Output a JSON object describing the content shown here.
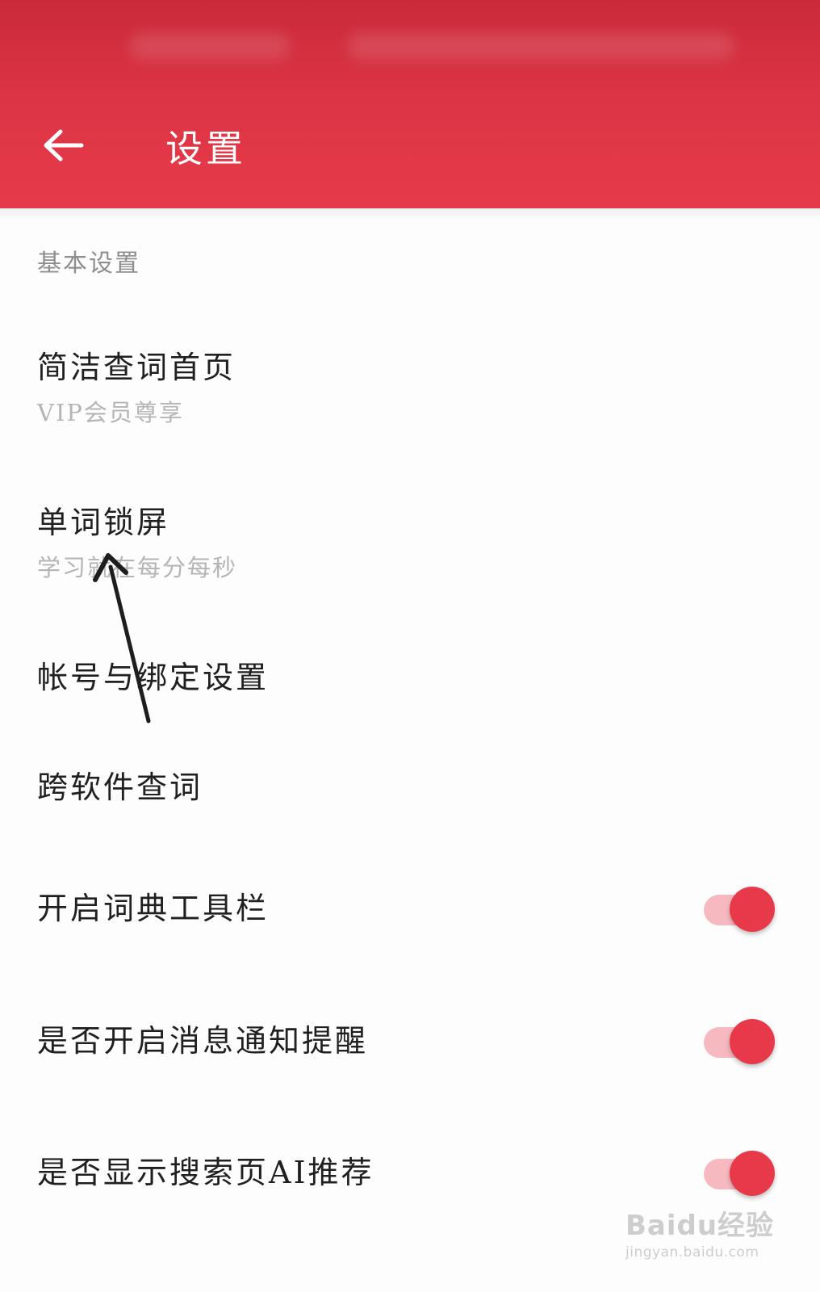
{
  "header": {
    "title": "设置",
    "back_icon": "arrow-left-icon",
    "background": "#e63a4a"
  },
  "section": {
    "title": "基本设置"
  },
  "items": [
    {
      "title": "简洁查词首页",
      "subtitle": "VIP会员尊享"
    },
    {
      "title": "单词锁屏",
      "subtitle": "学习就在每分每秒"
    },
    {
      "title": "帐号与绑定设置"
    },
    {
      "title": "跨软件查词"
    },
    {
      "title": "开启词典工具栏",
      "toggle_on": true
    },
    {
      "title": "是否开启消息通知提醒",
      "toggle_on": true
    },
    {
      "title": "是否显示搜索页AI推荐",
      "toggle_on": true
    }
  ],
  "colors": {
    "accent": "#e8394a",
    "toggle_track": "#f6b9c0"
  },
  "watermark": {
    "logo": "Baidu经验",
    "url": "jingyan.baidu.com"
  }
}
